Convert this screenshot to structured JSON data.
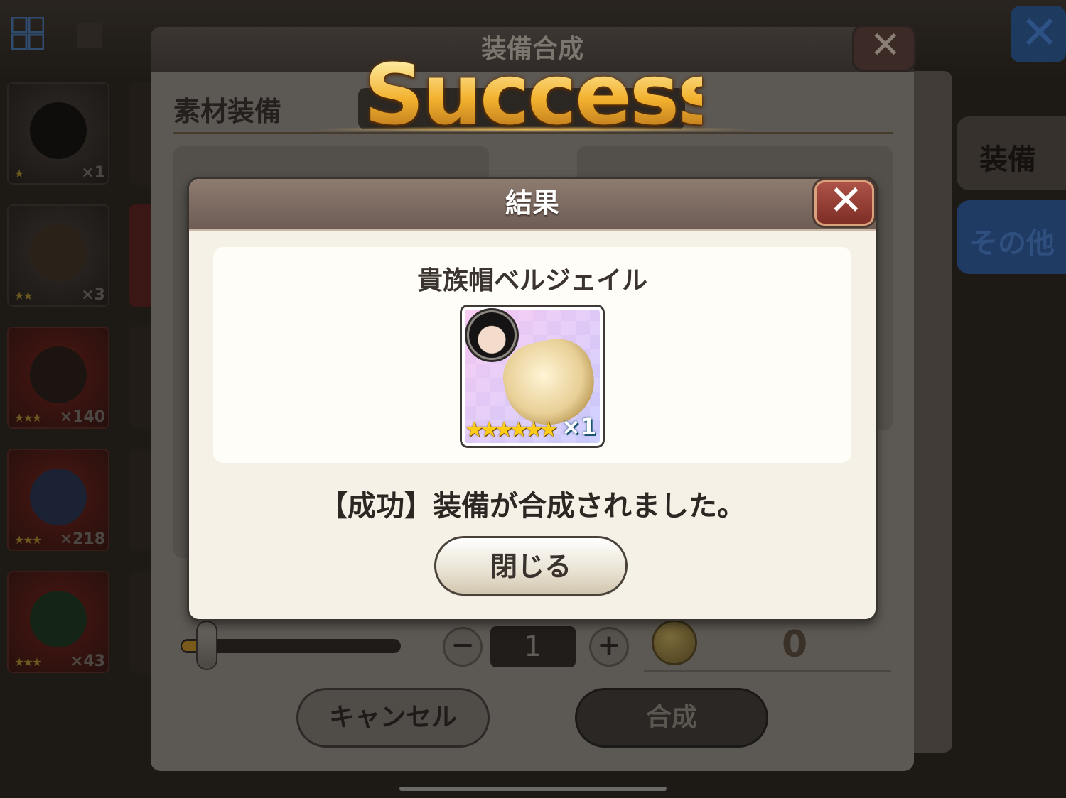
{
  "background": {
    "inventory_counts": [
      "×1",
      "×3",
      "×140",
      "×218",
      "×43"
    ],
    "inventory_stars": [
      "★",
      "★★",
      "★★★",
      "★★★",
      "★★★"
    ],
    "side_tabs": [
      "装備",
      "その他"
    ]
  },
  "main_dialog": {
    "title": "装備合成",
    "material_label": "素材装備",
    "quantity": "1",
    "cost": "0",
    "cancel_label": "キャンセル",
    "synthesize_label": "合成",
    "minus": "−",
    "plus": "+"
  },
  "banner": {
    "text": "Success"
  },
  "result_dialog": {
    "title": "結果",
    "item_name": "貴族帽ベルジェイル",
    "item_stars": "★★★★★★",
    "item_count": "×1",
    "message": "【成功】装備が合成されました。",
    "close_label": "閉じる"
  },
  "colors": {
    "result_header": "#7d6b62",
    "close_red": "#9a3f35",
    "success_gold": "#f2b12e"
  }
}
